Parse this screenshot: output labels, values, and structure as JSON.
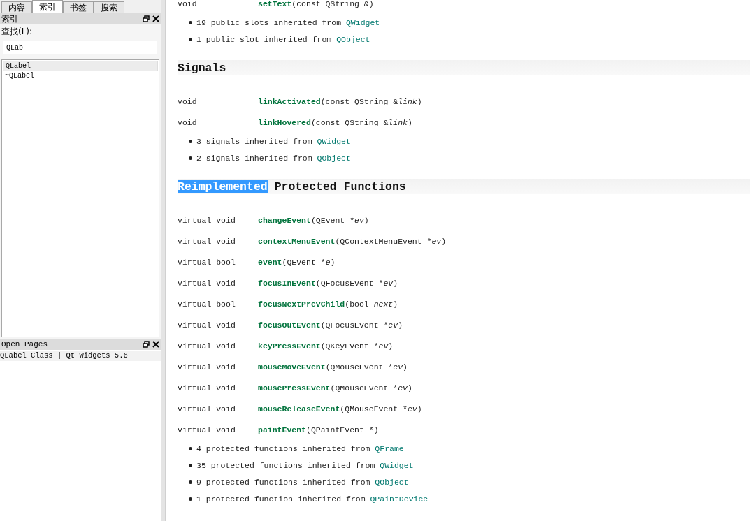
{
  "sidebar": {
    "tabs": [
      {
        "label": "内容",
        "selected": false
      },
      {
        "label": "索引",
        "selected": true
      },
      {
        "label": "书签",
        "selected": false
      },
      {
        "label": "搜索",
        "selected": false
      }
    ],
    "index_panel": {
      "title": "索引",
      "find_label": "查找(L):",
      "search": {
        "value": "QLab"
      },
      "items": [
        {
          "label": "QLabel",
          "selected": true
        },
        {
          "label": "~QLabel",
          "selected": false
        }
      ]
    },
    "open_pages": {
      "title": "Open Pages",
      "items": [
        {
          "label": "QLabel Class | Qt Widgets 5.6",
          "selected": true
        }
      ]
    }
  },
  "content": {
    "sections": [
      {
        "functions": [
          {
            "type": "void",
            "name": "setText",
            "before": "(const QString &)"
          }
        ],
        "inherited": [
          {
            "text": "19 public slots inherited from ",
            "link": "QWidget"
          },
          {
            "text": "1 public slot inherited from ",
            "link": "QObject"
          }
        ]
      },
      {
        "heading": {
          "plain": "Signals"
        },
        "functions": [
          {
            "type": "void",
            "name": "linkActivated",
            "before": "(const QString &",
            "arg": "link",
            "after": ")"
          },
          {
            "type": "void",
            "name": "linkHovered",
            "before": "(const QString &",
            "arg": "link",
            "after": ")"
          }
        ],
        "inherited": [
          {
            "text": "3 signals inherited from ",
            "link": "QWidget"
          },
          {
            "text": "2 signals inherited from ",
            "link": "QObject"
          }
        ]
      },
      {
        "heading": {
          "highlighted": "Reimplemented",
          "plain": " Protected Functions"
        },
        "functions": [
          {
            "type": "virtual void",
            "name": "changeEvent",
            "before": "(QEvent *",
            "arg": "ev",
            "after": ")"
          },
          {
            "type": "virtual void",
            "name": "contextMenuEvent",
            "before": "(QContextMenuEvent *",
            "arg": "ev",
            "after": ")"
          },
          {
            "type": "virtual bool",
            "name": "event",
            "before": "(QEvent *",
            "arg": "e",
            "after": ")"
          },
          {
            "type": "virtual void",
            "name": "focusInEvent",
            "before": "(QFocusEvent *",
            "arg": "ev",
            "after": ")"
          },
          {
            "type": "virtual bool",
            "name": "focusNextPrevChild",
            "before": "(bool ",
            "arg": "next",
            "after": ")"
          },
          {
            "type": "virtual void",
            "name": "focusOutEvent",
            "before": "(QFocusEvent *",
            "arg": "ev",
            "after": ")"
          },
          {
            "type": "virtual void",
            "name": "keyPressEvent",
            "before": "(QKeyEvent *",
            "arg": "ev",
            "after": ")"
          },
          {
            "type": "virtual void",
            "name": "mouseMoveEvent",
            "before": "(QMouseEvent *",
            "arg": "ev",
            "after": ")"
          },
          {
            "type": "virtual void",
            "name": "mousePressEvent",
            "before": "(QMouseEvent *",
            "arg": "ev",
            "after": ")"
          },
          {
            "type": "virtual void",
            "name": "mouseReleaseEvent",
            "before": "(QMouseEvent *",
            "arg": "ev",
            "after": ")"
          },
          {
            "type": "virtual void",
            "name": "paintEvent",
            "before": "(QPaintEvent *)"
          }
        ],
        "inherited": [
          {
            "text": "4 protected functions inherited from ",
            "link": "QFrame"
          },
          {
            "text": "35 protected functions inherited from ",
            "link": "QWidget"
          },
          {
            "text": "9 protected functions inherited from ",
            "link": "QObject"
          },
          {
            "text": "1 protected function inherited from ",
            "link": "QPaintDevice"
          }
        ]
      }
    ]
  }
}
